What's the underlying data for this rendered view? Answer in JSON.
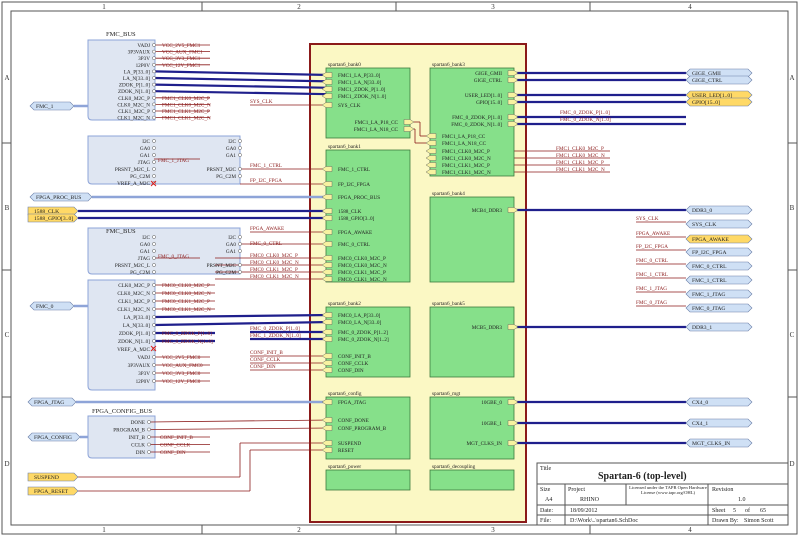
{
  "border": {
    "cols": [
      "1",
      "2",
      "3",
      "4"
    ],
    "rows": [
      "A",
      "B",
      "C",
      "D"
    ]
  },
  "colors": {
    "sheet_fill": "#fbf8c4",
    "sheet_border": "#8b1a1a",
    "block_fill": "#86e08a",
    "block_border": "#3d7a3d",
    "bus": "#1f1f8c",
    "bus_light": "#8ea4d8",
    "net": "#8b1a1a",
    "port_fill": "#cfe0f5",
    "port_yellow": "#ffd966",
    "harness_fill": "#dfe6f2"
  },
  "harness_top": {
    "title": "FMC_BUS",
    "entries": [
      "VADJ",
      "3P3VAUX",
      "3P3V",
      "12P0V",
      "LA_P[33..0]",
      "LA_N[33..0]",
      "ZDOK_P[1..0]",
      "ZDOK_N[1..0]",
      "CLK0_M2C_P",
      "CLK0_M2C_N",
      "CLK1_M2C_P",
      "CLK1_M2C_N"
    ],
    "nets": [
      "VCC_2V5_FMC1",
      "VCC_AUX_FMC1",
      "VCC_3V3_FMC1",
      "VCC_12V_FMC1",
      "",
      "",
      "",
      "",
      "FMC1_CLK0_M2C_P",
      "FMC1_CLK0_M2C_N",
      "FMC1_CLK1_M2C_P",
      "FMC1_CLK1_M2C_N"
    ]
  },
  "harness_i2c_1": {
    "left": [
      "I2C",
      "GA0",
      "GA1",
      "JTAG",
      "PRSNT_M2C_L",
      "PG_C2M",
      "VREF_A_M2C"
    ],
    "right": [
      "I2C",
      "GA0",
      "GA1",
      "",
      "PRSNT_M2C",
      "PG_C2M",
      ""
    ],
    "jtag_net": "FMC_1_JTAG",
    "ctrl_net": "FMC_1_CTRL",
    "i2c_net": "FP_I2C_FPGA"
  },
  "harness_mid": {
    "title": "FMC_BUS",
    "left": [
      "I2C",
      "GA0",
      "GA1",
      "JTAG",
      "PRSNT_M2C_L",
      "PG_C2M"
    ],
    "right": [
      "I2C",
      "GA0",
      "GA1",
      "",
      "PRSNT_M2C",
      "PG_C2M"
    ],
    "jtag_net": "FMC_0_JTAG",
    "ctrl_net": "FMC_0_CTRL"
  },
  "harness_bottom": {
    "entries": [
      "CLK0_M2C_P",
      "CLK0_M2C_N",
      "CLK1_M2C_P",
      "CLK1_M2C_N",
      "LA_P[33..0]",
      "LA_N[33..0]",
      "ZDOK_P[1..0]",
      "ZDOK_N[1..0]",
      "VREF_A_M2C",
      "VADJ",
      "3P3VAUX",
      "3P3V",
      "12P0V"
    ],
    "nets": [
      "FMC0_CLK0_M2C_P",
      "FMC0_CLK0_M2C_N",
      "FMC0_CLK1_M2C_P",
      "FMC0_CLK1_M2C_N",
      "",
      "",
      "FMC_0_ZDOK_P[1..0]",
      "FMC_0_ZDOK_N[1..0]",
      "",
      "VCC_2V5_FMC0",
      "VCC_AUX_FMC0",
      "VCC_3V3_FMC0",
      "VCC_12V_FMC0"
    ]
  },
  "harness_config": {
    "title": "FPGA_CONFIG_BUS",
    "entries": [
      "DONE",
      "PROGRAM_B",
      "INIT_B",
      "CCLK",
      "DIN"
    ],
    "nets": [
      "",
      "",
      "CONF_INIT_B",
      "CONF_CCLK",
      "CONF_DIN"
    ]
  },
  "left_ports": {
    "fmc1": "FMC_1",
    "fmc0": "FMC_0",
    "proc_bus": "FPGA_PROC_BUS",
    "clk1588": "1588_CLK",
    "gpio1588": "1588_GPIO[3..0]",
    "jtag": "FPGA_JTAG",
    "config": "FPGA_CONFIG",
    "suspend": "SUSPEND",
    "reset": "FPGA_RESET",
    "sys_clk": "SYS_CLK",
    "fpga_awake": "FPGA_AWAKE",
    "conf_init_b": "CONF_INIT_B",
    "conf_cclk": "CONF_CCLK",
    "conf_din": "CONF_DIN",
    "fmc_0_zdok_p": "FMC_0_ZDOK_P[1..0]",
    "fmc_1_zdok_n": "FMC_1_ZDOK_N[1..0]"
  },
  "blocks": {
    "bank0": {
      "title": "spartan6_bank0",
      "pins": [
        "FMC1_LA_P[33..0]",
        "FMC1_LA_N[33..0]",
        "FMC1_ZDOK_P[1..0]",
        "FMC1_ZDOK_N[1..0]",
        "SYS_CLK",
        "FMC1_LA_P18_CC",
        "FMC1_LA_N18_CC"
      ]
    },
    "bank3": {
      "title": "spartan6_bank3",
      "pins": [
        "GIGE_GMII",
        "GIGE_CTRL",
        "USER_LED[1..0]",
        "GPIO[15..0]",
        "FMC_0_ZDOK_P[1..0]",
        "FMC_0_ZDOK_N[1..0]",
        "FMC1_LA_P18_CC",
        "FMC1_LA_N18_CC",
        "FMC1_CLK0_M2C_P",
        "FMC1_CLK0_M2C_N",
        "FMC1_CLK1_M2C_P",
        "FMC1_CLK1_M2C_N"
      ]
    },
    "bank1": {
      "title": "spartan6_bank1",
      "pins": [
        "FMC_1_CTRL",
        "FP_I2C_FPGA",
        "FPGA_PROC_BUS",
        "1588_CLK",
        "1588_GPIO[3..0]",
        "FPGA_AWAKE",
        "FMC_0_CTRL",
        "FMC0_CLK0_M2C_P",
        "FMC0_CLK0_M2C_N",
        "FMC0_CLK1_M2C_P",
        "FMC0_CLK1_M2C_N"
      ]
    },
    "bank4": {
      "title": "spartan6_bank4",
      "pins": [
        "MCB4_DDR3"
      ]
    },
    "bank2": {
      "title": "spartan6_bank2",
      "pins": [
        "FMC0_LA_P[33..0]",
        "FMC0_LA_N[33..0]",
        "FMC_0_ZDOK_P[1..2]",
        "FMC_0_ZDOK_N[1..2]",
        "CONF_INIT_B",
        "CONF_CCLK",
        "CONF_DIN"
      ]
    },
    "bank5": {
      "title": "spartan6_bank5",
      "pins": [
        "MCB5_DDR3"
      ]
    },
    "config": {
      "title": "spartan6_config",
      "pins": [
        "FPGA_JTAG",
        "CONF_DONE",
        "CONF_PROGRAM_B",
        "SUSPEND",
        "RESET"
      ]
    },
    "mgt": {
      "title": "spartan6_mgt",
      "pins": [
        "10GBE_0",
        "10GBE_1",
        "MGT_CLKS_IN"
      ]
    },
    "power": {
      "title": "spartan6_power"
    },
    "decoupling": {
      "title": "spartan6_decoupling"
    }
  },
  "right_ports": [
    "GIGE_GMII",
    "GIGE_CTRL",
    "USER_LED[1..0]",
    "GPIO[15..0]",
    "DDR3_0",
    "SYS_CLK",
    "FPGA_AWAKE",
    "FP_I2C_FPGA",
    "FMC_0_CTRL",
    "FMC_1_CTRL",
    "FMC_1_JTAG",
    "FMC_0_JTAG",
    "DDR3_1",
    "CX4_0",
    "CX4_1",
    "MGT_CLKS_IN"
  ],
  "right_nets": {
    "zdok_p": "FMC_0_ZDOK_P[1..0]",
    "zdok_n": "FMC_0_ZDOK_N[1..0]",
    "clk": [
      "FMC1_CLK0_M2C_P",
      "FMC1_CLK0_M2C_N",
      "FMC1_CLK1_M2C_P",
      "FMC1_CLK1_M2C_N"
    ],
    "stubs": [
      "SYS_CLK",
      "FPGA_AWAKE",
      "FP_I2C_FPGA",
      "FMC_0_CTRL",
      "FMC_1_CTRL",
      "FMC_1_JTAG",
      "FMC_0_JTAG"
    ]
  },
  "titleblock": {
    "title_label": "Title",
    "title": "Spartan-6 (top-level)",
    "size_label": "Size",
    "size": "A4",
    "project_label": "Project",
    "project": "RHINO",
    "license": "Licensed under the TAPR Open Hardware License (www.tapr.org/OHL)",
    "revision_label": "Revision",
    "revision": "1.0",
    "date_label": "Date:",
    "date": "18/09/2012",
    "sheet_label": "Sheet",
    "sheet": "5",
    "of_label": "of",
    "sheets": "65",
    "file_label": "File:",
    "file": "D:\\Work\\..\\spartan6.SchDoc",
    "drawn_label": "Drawn By:",
    "drawn": "Simon Scott"
  }
}
